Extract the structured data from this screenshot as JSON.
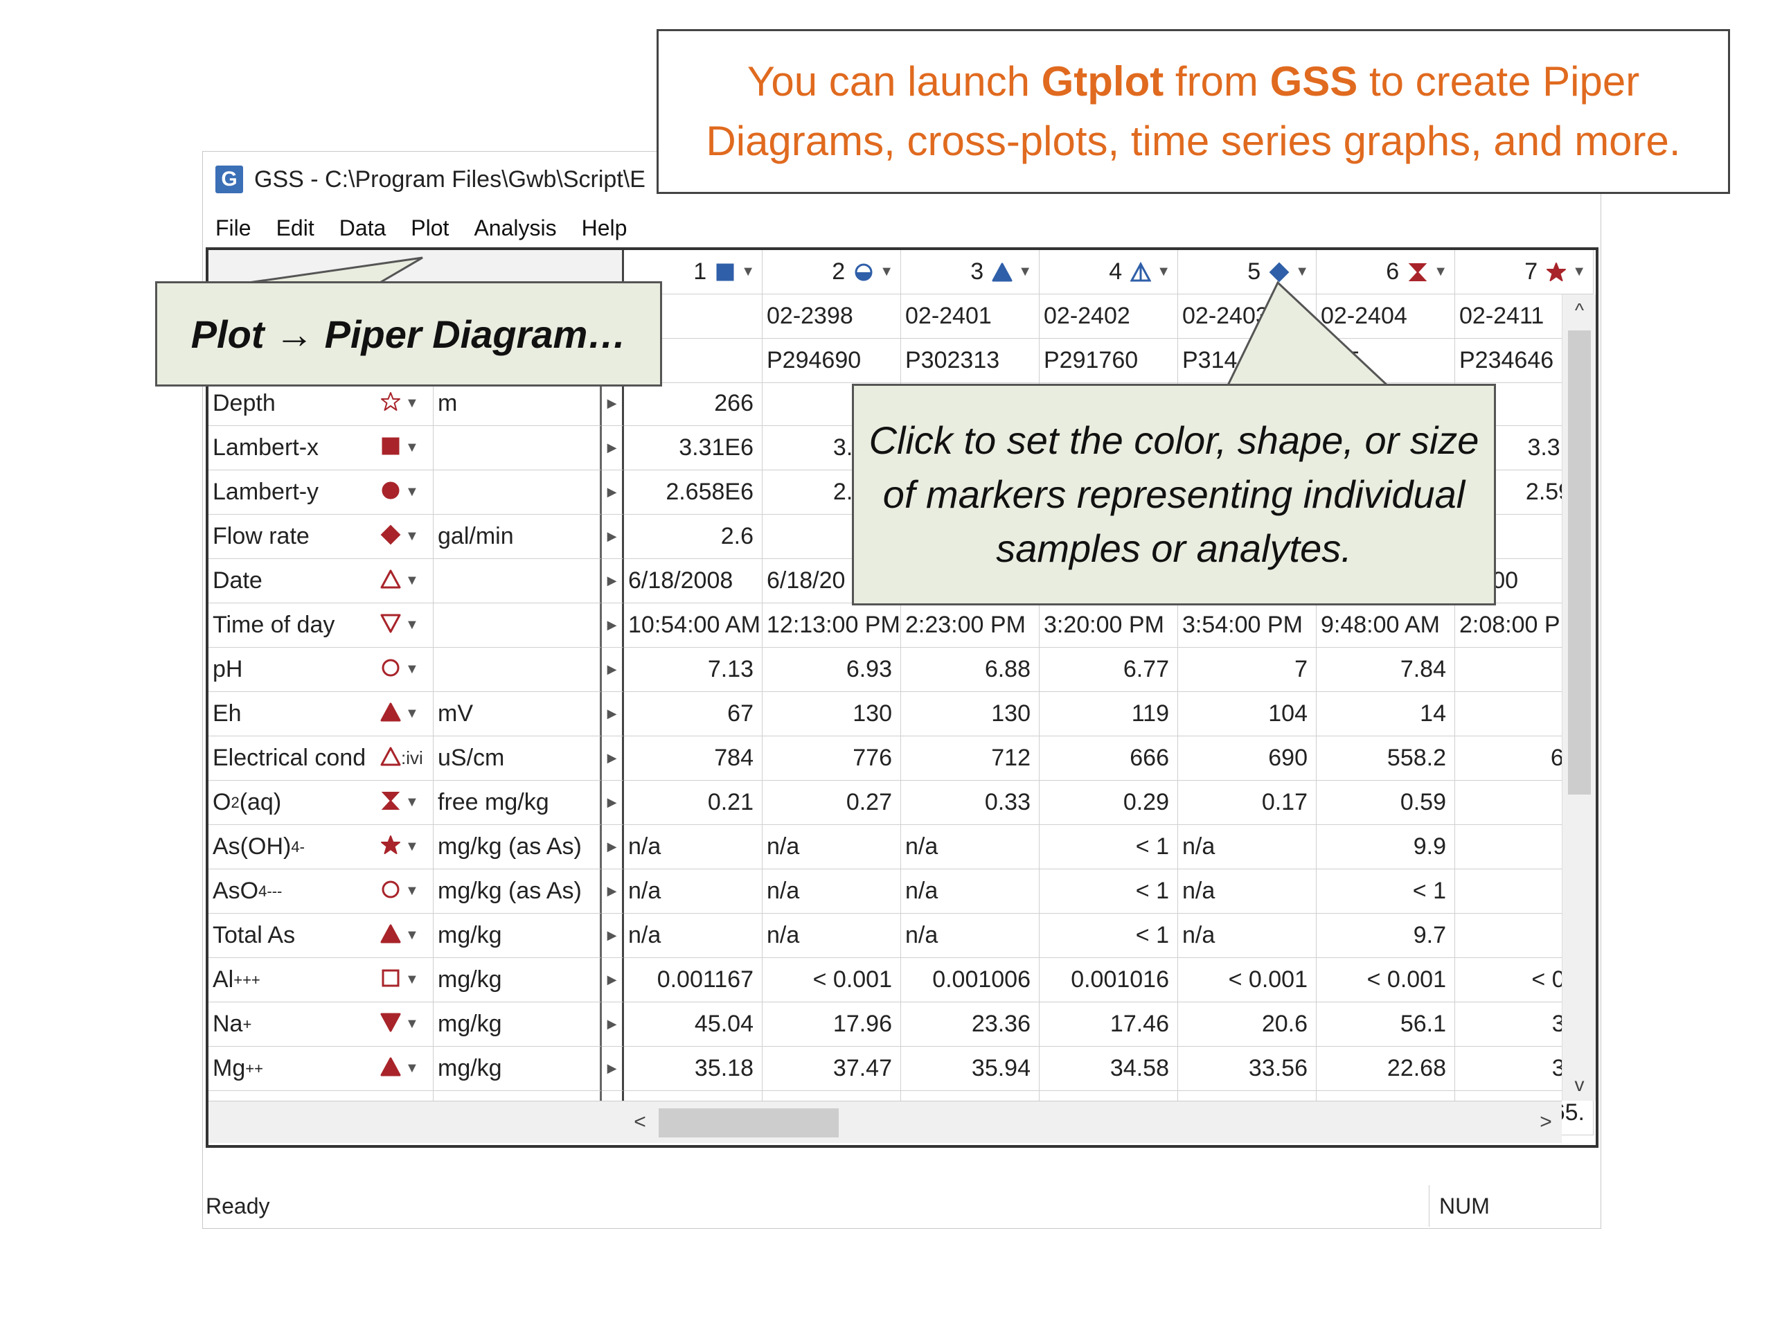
{
  "window": {
    "title": "GSS - C:\\Program Files\\Gwb\\Script\\E",
    "app_icon": "G"
  },
  "menu": [
    "File",
    "Edit",
    "Data",
    "Plot",
    "Analysis",
    "Help"
  ],
  "columns": [
    {
      "num": "1",
      "marker": {
        "shape": "square",
        "color": "#2f5fa8",
        "filled": true
      },
      "id1": "97",
      "id2": "66"
    },
    {
      "num": "2",
      "marker": {
        "shape": "half-circle",
        "color": "#2f5fa8",
        "filled": true
      },
      "id1": "02-2398",
      "id2": "P294690"
    },
    {
      "num": "3",
      "marker": {
        "shape": "triangle-up",
        "color": "#2f5fa8",
        "filled": true
      },
      "id1": "02-2401",
      "id2": "P302313"
    },
    {
      "num": "4",
      "marker": {
        "shape": "triangle-split",
        "color": "#2f5fa8",
        "filled": false
      },
      "id1": "02-2402",
      "id2": "P291760"
    },
    {
      "num": "5",
      "marker": {
        "shape": "diamond",
        "color": "#2f5fa8",
        "filled": true
      },
      "id1": "02-2403",
      "id2": "P314"
    },
    {
      "num": "6",
      "marker": {
        "shape": "hourglass",
        "color": "#a8242a",
        "filled": true
      },
      "id1": "02-2404",
      "id2": "325"
    },
    {
      "num": "7",
      "marker": {
        "shape": "star",
        "color": "#a8242a",
        "filled": true
      },
      "id1": "02-2411",
      "id2": "P234646"
    }
  ],
  "rows": [
    {
      "label": "Depth",
      "sup": "",
      "sub": "",
      "marker": {
        "shape": "star",
        "color": "#a8242a",
        "filled": false
      },
      "unit": "m",
      "values": [
        "266",
        "",
        "",
        "",
        "",
        "",
        "2"
      ]
    },
    {
      "label": "Lambert-x",
      "sup": "",
      "sub": "",
      "marker": {
        "shape": "square",
        "color": "#a8242a",
        "filled": true
      },
      "unit": "",
      "values": [
        "3.31E6",
        "3.315",
        "",
        "",
        "",
        "",
        "3.311"
      ]
    },
    {
      "label": "Lambert-y",
      "sup": "",
      "sub": "",
      "marker": {
        "shape": "circle",
        "color": "#a8242a",
        "filled": true
      },
      "unit": "",
      "values": [
        "2.658E6",
        "2.626",
        "",
        "",
        "",
        "",
        "2.598"
      ]
    },
    {
      "label": "Flow rate",
      "sup": "",
      "sub": "",
      "marker": {
        "shape": "diamond",
        "color": "#a8242a",
        "filled": true
      },
      "unit": "gal/min",
      "values": [
        "2.6",
        "",
        "",
        "",
        "",
        "",
        ""
      ]
    },
    {
      "label": "Date",
      "sup": "",
      "sub": "",
      "marker": {
        "shape": "triangle-up",
        "color": "#a8242a",
        "filled": false
      },
      "unit": "",
      "values": [
        "6/18/2008",
        "6/18/20",
        "",
        "",
        "",
        "",
        "8/200"
      ],
      "left": true
    },
    {
      "label": "Time of day",
      "sup": "",
      "sub": "",
      "marker": {
        "shape": "triangle-down",
        "color": "#a8242a",
        "filled": false
      },
      "unit": "",
      "values": [
        "10:54:00 AM",
        "12:13:00 PM",
        "2:23:00 PM",
        "3:20:00 PM",
        "3:54:00 PM",
        "9:48:00 AM",
        "2:08:00 PM"
      ],
      "left": true
    },
    {
      "label": "pH",
      "sup": "",
      "sub": "",
      "marker": {
        "shape": "circle",
        "color": "#a8242a",
        "filled": false
      },
      "unit": "",
      "values": [
        "7.13",
        "6.93",
        "6.88",
        "6.77",
        "7",
        "7.84",
        "7."
      ]
    },
    {
      "label": "Eh",
      "sup": "",
      "sub": "",
      "marker": {
        "shape": "triangle-up",
        "color": "#a8242a",
        "filled": true
      },
      "unit": "mV",
      "values": [
        "67",
        "130",
        "130",
        "119",
        "104",
        "14",
        ""
      ]
    },
    {
      "label": "Electrical cond",
      "sup": "",
      "sub": "",
      "marker": {
        "shape": "triangle-up",
        "color": "#a8242a",
        "filled": false
      },
      "unit": "uS/cm",
      "values": [
        "784",
        "776",
        "712",
        "666",
        "690",
        "558.2",
        "68("
      ],
      "marker_suffix": ":ivi"
    },
    {
      "label": "O",
      "sup": "",
      "sub": "2",
      "tail": "(aq)",
      "marker": {
        "shape": "hourglass",
        "color": "#a8242a",
        "filled": true
      },
      "unit": "free mg/kg",
      "values": [
        "0.21",
        "0.27",
        "0.33",
        "0.29",
        "0.17",
        "0.59",
        "0."
      ]
    },
    {
      "label": "As(OH)",
      "sup": "-",
      "sub": "4",
      "tail": "",
      "marker": {
        "shape": "star",
        "color": "#a8242a",
        "filled": true
      },
      "unit": "mg/kg (as As)",
      "values": [
        "n/a",
        "n/a",
        "n/a",
        "< 1",
        "n/a",
        "9.9",
        "<"
      ]
    },
    {
      "label": "AsO",
      "sup": "---",
      "sub": "4",
      "tail": "",
      "marker": {
        "shape": "circle",
        "color": "#a8242a",
        "filled": false
      },
      "unit": "mg/kg (as As)",
      "values": [
        "n/a",
        "n/a",
        "n/a",
        "< 1",
        "n/a",
        "< 1",
        "<"
      ]
    },
    {
      "label": "Total As",
      "sup": "",
      "sub": "",
      "marker": {
        "shape": "triangle-up",
        "color": "#a8242a",
        "filled": true
      },
      "unit": "mg/kg",
      "values": [
        "n/a",
        "n/a",
        "n/a",
        "< 1",
        "n/a",
        "9.7",
        "<"
      ]
    },
    {
      "label": "Al",
      "sup": "+++",
      "sub": "",
      "marker": {
        "shape": "square",
        "color": "#a8242a",
        "filled": false
      },
      "unit": "mg/kg",
      "values": [
        "0.001167",
        "< 0.001",
        "0.001006",
        "0.001016",
        "< 0.001",
        "< 0.001",
        "< 0.0"
      ]
    },
    {
      "label": "Na",
      "sup": "+",
      "sub": "",
      "marker": {
        "shape": "triangle-down",
        "color": "#a8242a",
        "filled": true
      },
      "unit": "mg/kg",
      "values": [
        "45.04",
        "17.96",
        "23.36",
        "17.46",
        "20.6",
        "56.1",
        "31."
      ]
    },
    {
      "label": "Mg",
      "sup": "++",
      "sub": "",
      "marker": {
        "shape": "triangle-up",
        "color": "#a8242a",
        "filled": true
      },
      "unit": "mg/kg",
      "values": [
        "35.18",
        "37.47",
        "35.94",
        "34.58",
        "33.56",
        "22.68",
        "30."
      ]
    },
    {
      "label": "Ca",
      "sup": "++",
      "sub": "",
      "marker": {
        "shape": "circle",
        "color": "#a8242a",
        "filled": true
      },
      "unit": "mg/kg",
      "values": [
        "76.99",
        "89.77",
        "76.94",
        "75.64",
        "77.21",
        "40.1",
        "65."
      ]
    }
  ],
  "status": {
    "ready": "Ready",
    "num": "NUM"
  },
  "scroll": {
    "up": "^",
    "down": "v",
    "left": "<",
    "right": ">"
  },
  "callouts": {
    "top": {
      "pre": "You can launch ",
      "b1": "Gtplot",
      "mid": " from ",
      "b2": "GSS",
      "post": " to create Piper Diagrams, cross-plots, time series graphs, and more."
    },
    "plot": "Plot → Piper Diagram…",
    "marker": "Click to set the color, shape, or size of markers representing individual samples or analytes."
  },
  "colors": {
    "accent_orange": "#e06a1f",
    "balloon_fill": "#e9eddf",
    "marker_blue": "#2f5fa8",
    "marker_red": "#a8242a"
  }
}
